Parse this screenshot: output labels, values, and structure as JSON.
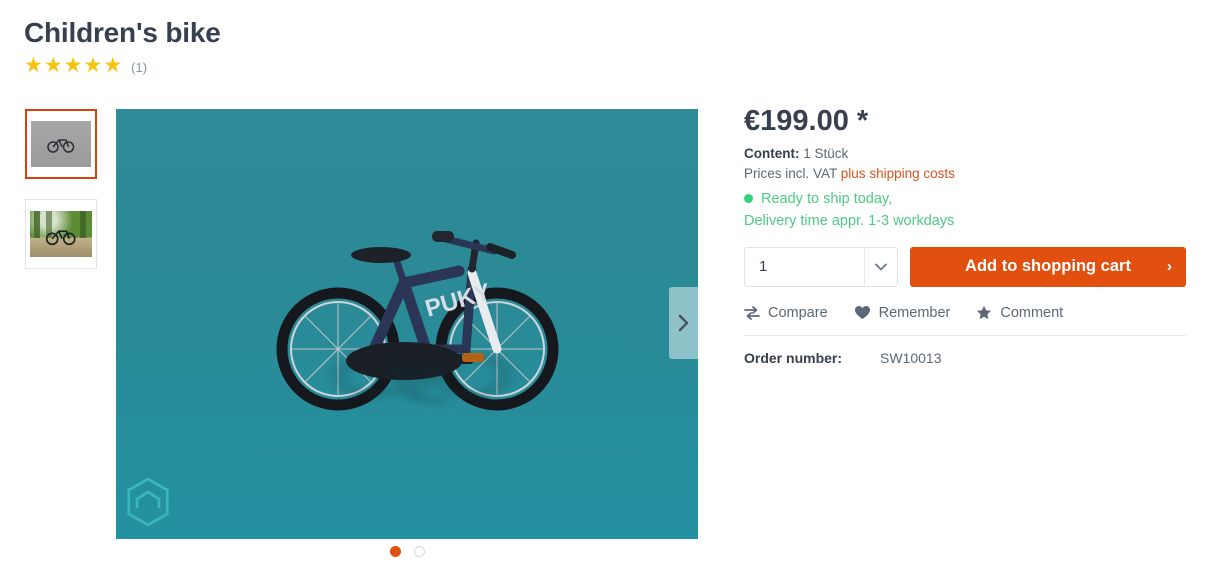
{
  "product": {
    "title": "Children's bike",
    "rating": {
      "stars": 5,
      "star_glyph": "★",
      "count_label": "(1)"
    }
  },
  "gallery": {
    "thumbnails": [
      {
        "name": "thumbnail-studio-bike",
        "active": true
      },
      {
        "name": "thumbnail-forest-bike",
        "active": false
      }
    ],
    "next_arrow_icon": "chevron-right-icon",
    "watermark_icon": "hexagon-logo-icon",
    "dots": [
      {
        "active": true
      },
      {
        "active": false
      }
    ]
  },
  "buybox": {
    "price": "€199.00 *",
    "content_label": "Content:",
    "content_value": "1 Stück",
    "vat_text": "Prices incl. VAT",
    "shipping_link": "plus shipping costs",
    "availability": "Ready to ship today,",
    "delivery": "Delivery time appr. 1-3 workdays",
    "quantity_value": "1",
    "quantity_caret_icon": "chevron-down-icon",
    "add_to_cart_label": "Add to shopping cart",
    "add_to_cart_chevron": "›",
    "actions": [
      {
        "label": "Compare",
        "icon": "compare-arrows-icon"
      },
      {
        "label": "Remember",
        "icon": "heart-icon"
      },
      {
        "label": "Comment",
        "icon": "star-icon"
      }
    ],
    "order_number_label": "Order number:",
    "order_number_value": "SW10013"
  },
  "colors": {
    "accent_orange": "#e1500f",
    "star_gold": "#f5c311",
    "available_green": "#4ecb82",
    "stage_teal": "#2a8a96",
    "heading": "#36404e"
  }
}
